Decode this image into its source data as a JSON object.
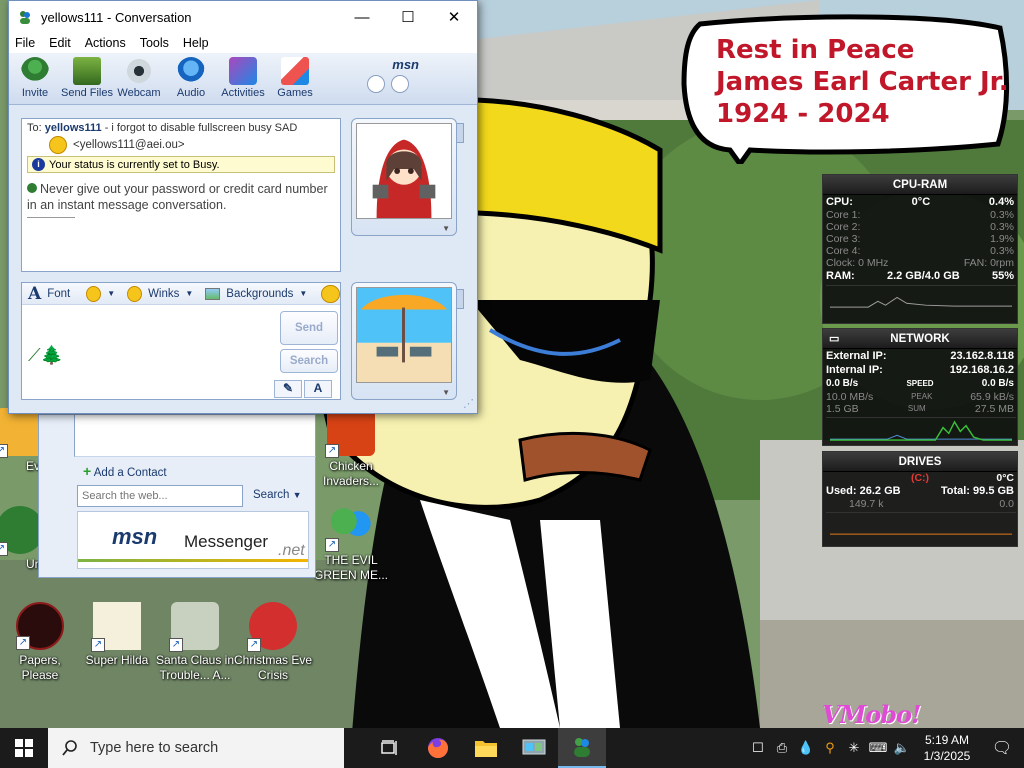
{
  "desktop": {
    "bubble": {
      "line1": "Rest in Peace",
      "line2": "James Earl Carter Jr.",
      "line3": "1924 - 2024"
    },
    "watermark": "VMobo!",
    "icons": [
      {
        "label": "Every",
        "icon": "app-icon"
      },
      {
        "label": "Undo",
        "icon": "app-icon"
      },
      {
        "label": "Papers, Please",
        "icon": "game-icon"
      },
      {
        "label": "Super Hilda",
        "icon": "game-icon"
      },
      {
        "label": "Santa Claus in Trouble... A...",
        "icon": "game-icon"
      },
      {
        "label": "Christmas Eve Crisis",
        "icon": "game-icon"
      },
      {
        "label": "Chicken Invaders...",
        "icon": "game-icon"
      },
      {
        "label": "THE EVIL GREEN ME...",
        "icon": "msn-people-icon"
      }
    ]
  },
  "conversation": {
    "title": "yellows111 - Conversation",
    "menu": [
      "File",
      "Edit",
      "Actions",
      "Tools",
      "Help"
    ],
    "toolbar": [
      "Invite",
      "Send Files",
      "Webcam",
      "Audio",
      "Activities",
      "Games"
    ],
    "brand": "msn",
    "to_prefix": "To:",
    "to_name": "yellows111",
    "to_message": " - i forgot to disable fullscreen busy SAD",
    "to_email": "<yellows111@aei.ou>",
    "status_notice": "Your status is currently set to Busy.",
    "security_warning": "Never give out your password or credit card number in an instant message conversation.",
    "compose": {
      "font_label": "Font",
      "winks_label": "Winks",
      "backgrounds_label": "Backgrounds",
      "input_value": "",
      "send_label": "Send",
      "search_label": "Search",
      "handwriting_label": "✎",
      "text_label": "A"
    }
  },
  "contact_list": {
    "add_contact": "Add a Contact",
    "search_placeholder": "Search the web...",
    "search_label": "Search",
    "banner_msn": "msn",
    "banner_messenger": "Messenger",
    "banner_net": ".net"
  },
  "gadgets": {
    "cpu_ram": {
      "title": "CPU-RAM",
      "cpu_label": "CPU:",
      "cpu_temp": "0°C",
      "cpu_total": "0.4%",
      "cores": [
        {
          "label": "Core 1:",
          "value": "0.3%"
        },
        {
          "label": "Core 2:",
          "value": "0.3%"
        },
        {
          "label": "Core 3:",
          "value": "1.9%"
        },
        {
          "label": "Core 4:",
          "value": "0.3%"
        }
      ],
      "clock": "Clock: 0 MHz",
      "fan": "FAN: 0rpm",
      "ram_label": "RAM:",
      "ram_value": "2.2 GB/4.0 GB",
      "ram_pct": "55%"
    },
    "network": {
      "title": "NETWORK",
      "external_label": "External IP:",
      "external_ip": "23.162.8.118",
      "internal_label": "Internal IP:",
      "internal_ip": "192.168.16.2",
      "down_speed": "0.0 B/s",
      "speed_label": "SPEED",
      "up_speed": "0.0 B/s",
      "down_peak": "10.0 MB/s",
      "peak_label": "PEAK",
      "up_peak": "65.9 kB/s",
      "down_sum": "1.5 GB",
      "sum_label": "SUM",
      "up_sum": "27.5 MB"
    },
    "drives": {
      "title": "DRIVES",
      "drive_letter": "(C:)",
      "temp": "0°C",
      "used": "Used: 26.2 GB",
      "total": "Total: 99.5 GB",
      "read": "149.7 k",
      "write": "0.0"
    }
  },
  "taskbar": {
    "search_placeholder": "Type here to search",
    "apps": [
      "task-view-icon",
      "firefox-icon",
      "file-explorer-icon",
      "control-panel-icon",
      "msn-messenger-icon"
    ],
    "time": "5:19 AM",
    "date": "1/3/2025"
  },
  "colors": {
    "bubble_text": "#c0182a",
    "msn_blue": "#1b3a6e",
    "taskbar": "#1b1b1b"
  }
}
